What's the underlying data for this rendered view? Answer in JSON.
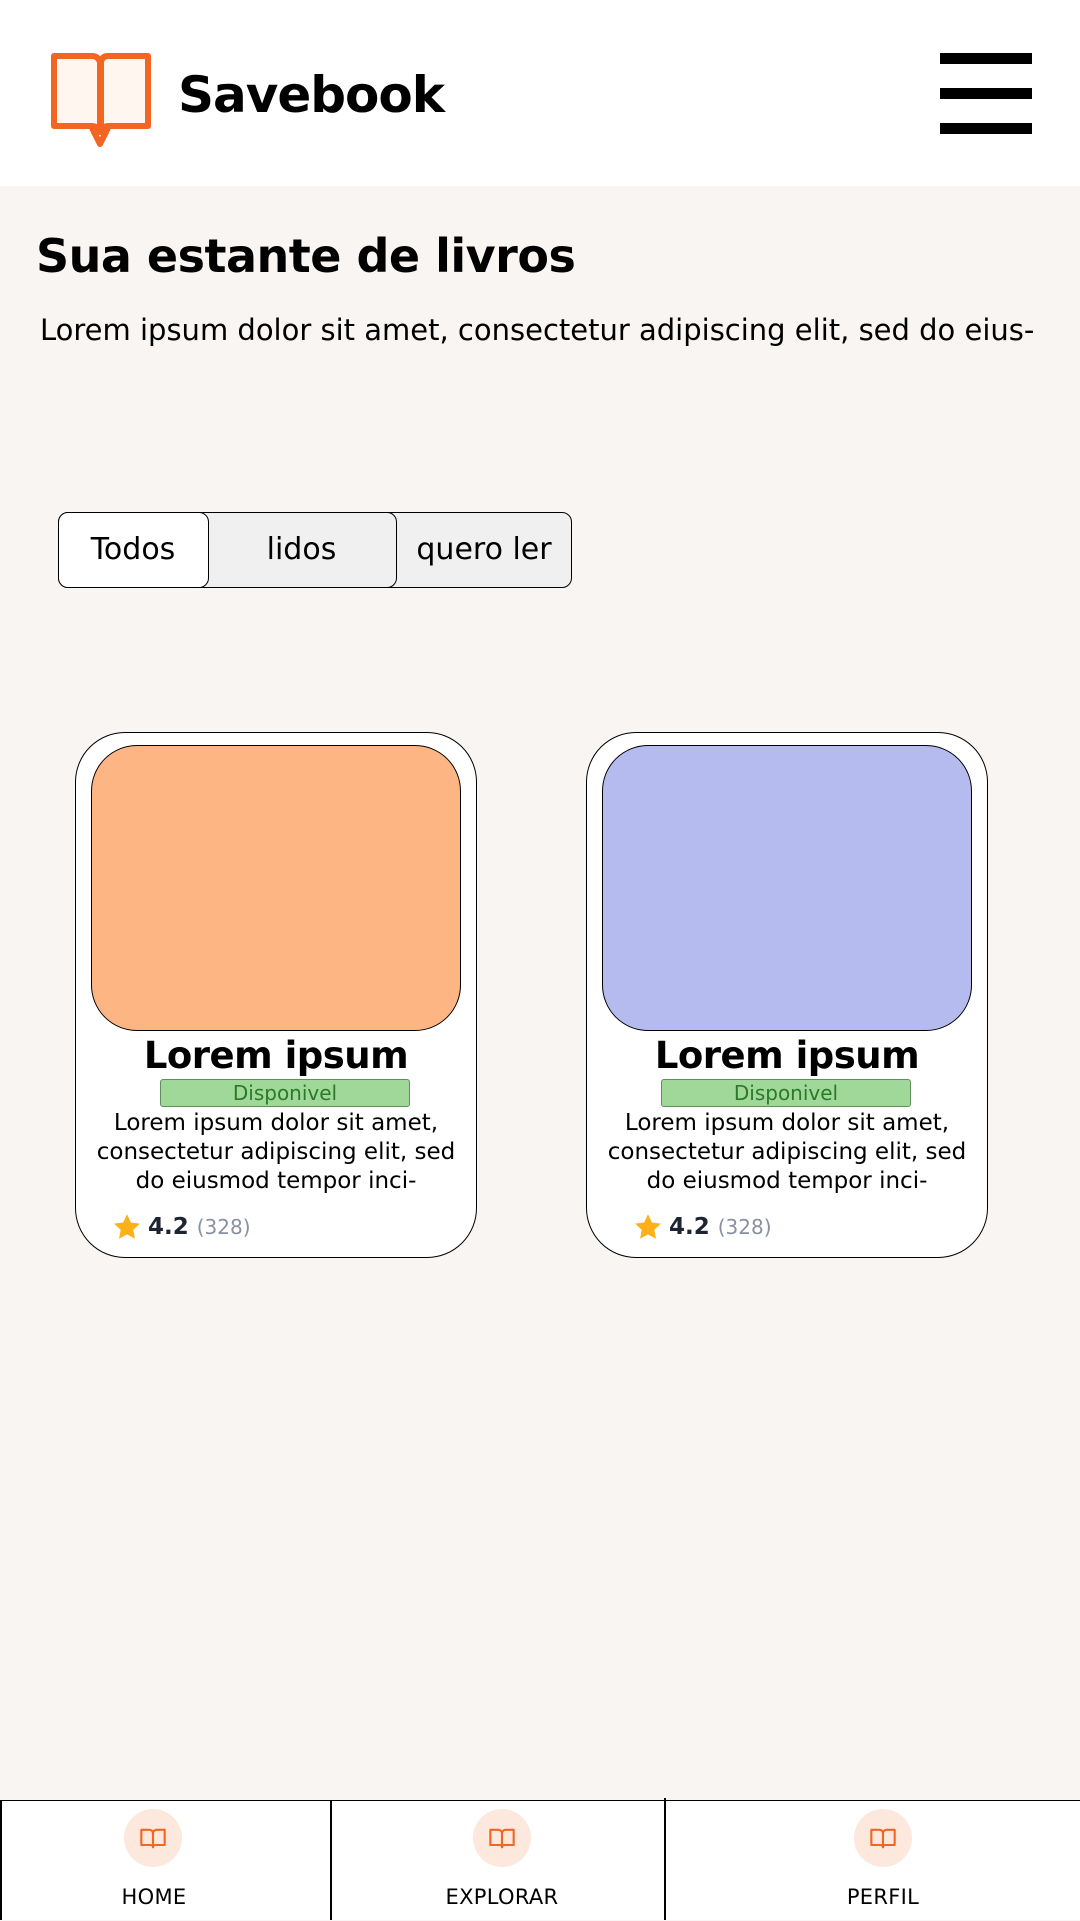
{
  "header": {
    "brand": "Savebook",
    "logo_icon": "open-book-icon",
    "menu_icon": "hamburger-icon",
    "accent_color": "#f26522"
  },
  "page": {
    "title": "Sua estante de livros",
    "subtitle": "Lorem ipsum dolor sit amet, consectetur adipiscing elit, sed do eius-"
  },
  "tabs": [
    {
      "label": "Todos",
      "active": true
    },
    {
      "label": "lidos",
      "active": false
    },
    {
      "label": "quero ler",
      "active": false
    }
  ],
  "books": [
    {
      "title": "Lorem ipsum",
      "status": "Disponivel",
      "description": "Lorem ipsum dolor sit amet, consectetur adipiscing elit, sed do eiusmod tempor inci-",
      "rating": "4.2",
      "reviews": "(328)",
      "cover_color": "#fdb584"
    },
    {
      "title": "Lorem ipsum",
      "status": "Disponivel",
      "description": "Lorem ipsum dolor sit amet, consectetur adipiscing elit, sed do eiusmod tempor inci-",
      "rating": "4.2",
      "reviews": "(328)",
      "cover_color": "#b5bbee"
    }
  ],
  "bottom_nav": [
    {
      "label": "HOME",
      "icon": "book-icon"
    },
    {
      "label": "EXPLORAR",
      "icon": "book-icon"
    },
    {
      "label": "PERFIL",
      "icon": "book-icon"
    }
  ]
}
